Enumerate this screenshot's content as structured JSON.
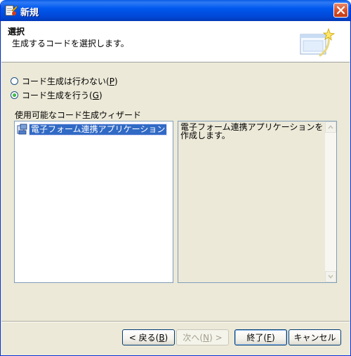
{
  "window": {
    "title": "新規",
    "colors": {
      "titlebar": "#0058ee",
      "selection": "#316ac5",
      "radio_dot": "#21a121"
    }
  },
  "header": {
    "title": "選択",
    "description": "生成するコードを選択します。",
    "graphic_icon": "wizard-banner-icon"
  },
  "options": {
    "no_generation": {
      "label": "コード生成は行わない",
      "mnemonic": "P",
      "checked": false
    },
    "generation": {
      "label": "コード生成を行う",
      "mnemonic": "G",
      "checked": true
    }
  },
  "wizards": {
    "section_label": "使用可能なコード生成ウィザード",
    "items": [
      {
        "label": "電子フォーム連携アプリケーション",
        "icon": "wizard-app-icon",
        "selected": true
      }
    ],
    "description": "電子フォーム連携アプリケーションを作成します。"
  },
  "buttons": {
    "back": {
      "label": "< 戻る",
      "mnemonic": "B",
      "enabled": true
    },
    "next": {
      "label": "次へ",
      "mnemonic": "N",
      "suffix": " >",
      "enabled": false
    },
    "finish": {
      "label": "終了",
      "mnemonic": "F",
      "enabled": true
    },
    "cancel": {
      "label": "キャンセル",
      "enabled": true
    }
  }
}
